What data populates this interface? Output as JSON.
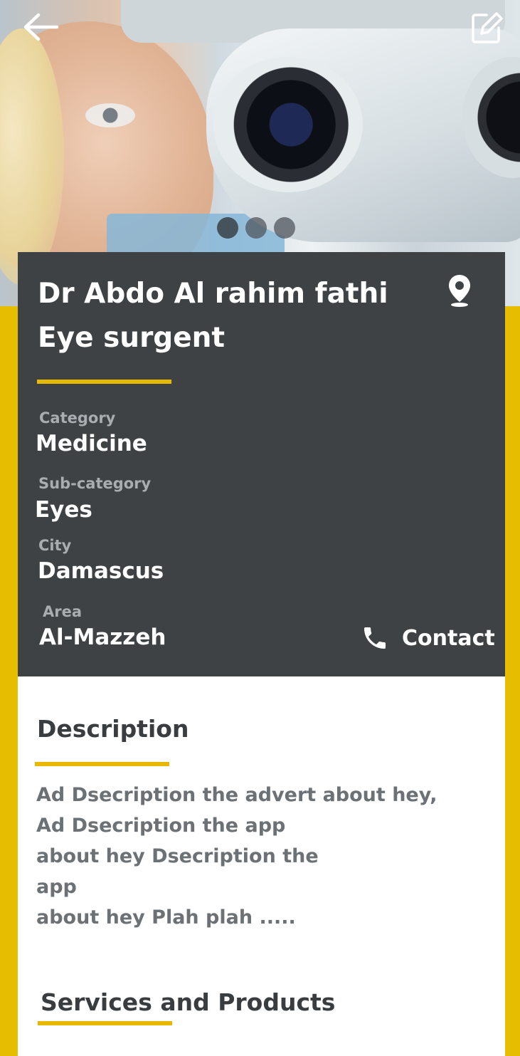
{
  "header": {
    "back_icon": "arrow-left-icon",
    "edit_icon": "edit-icon",
    "carousel": {
      "count": 3,
      "active_index": 0
    }
  },
  "profile": {
    "title": "Dr Abdo Al rahim fathi Eye surgent",
    "location_icon": "location-pin-icon",
    "fields": [
      {
        "label": "Category",
        "value": "Medicine"
      },
      {
        "label": "Sub-category",
        "value": "Eyes"
      },
      {
        "label": "City",
        "value": "Damascus"
      },
      {
        "label": "Area",
        "value": "Al-Mazzeh"
      }
    ],
    "contact_label": "Contact",
    "contact_icon": "phone-icon"
  },
  "description": {
    "heading": "Description",
    "text": "Ad Dsecription the advert about hey, Ad Dsecription the app\nabout hey Dsecription the\napp\nabout hey Plah plah ....."
  },
  "services": {
    "heading": "Services and Products"
  },
  "colors": {
    "accent": "#e6b800",
    "card_bg": "#3f4245",
    "page_bg": "#e6bd00"
  }
}
